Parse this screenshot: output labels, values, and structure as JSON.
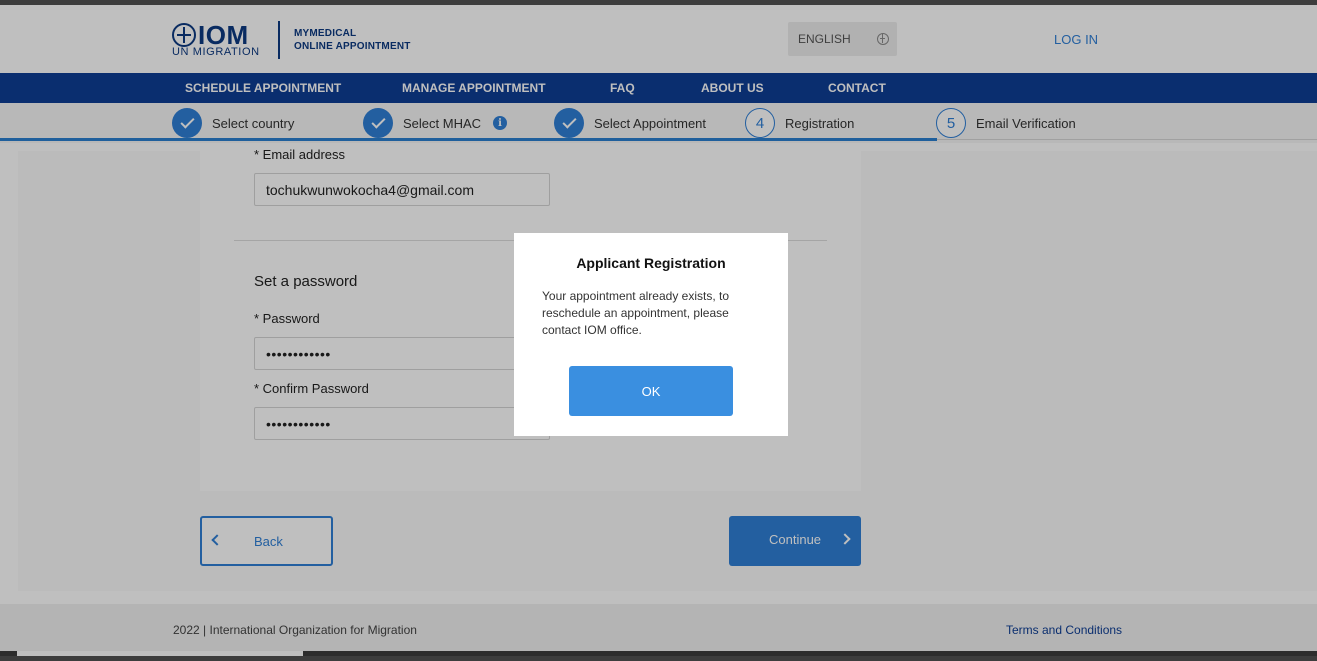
{
  "header": {
    "logo_main": "IOM",
    "logo_sub": "UN MIGRATION",
    "app_name_line1": "MYMEDICAL",
    "app_name_line2": "ONLINE APPOINTMENT",
    "language": "ENGLISH",
    "login": "LOG IN"
  },
  "nav": {
    "items": [
      "SCHEDULE APPOINTMENT",
      "MANAGE APPOINTMENT",
      "FAQ",
      "ABOUT US",
      "CONTACT"
    ]
  },
  "steps": [
    {
      "label": "Select country",
      "state": "done"
    },
    {
      "label": "Select MHAC",
      "state": "done",
      "info": "i"
    },
    {
      "label": "Select Appointment",
      "state": "done"
    },
    {
      "label": "Registration",
      "state": "current",
      "number": "4"
    },
    {
      "label": "Email Verification",
      "state": "pending",
      "number": "5"
    }
  ],
  "form": {
    "email_label": "* Email address",
    "email_value": "tochukwunwokocha4@gmail.com",
    "password_section_title": "Set a password",
    "password_label": "* Password",
    "password_value": "••••••••••••",
    "confirm_label": "* Confirm Password",
    "confirm_value": "••••••••••••"
  },
  "buttons": {
    "back": "Back",
    "continue": "Continue"
  },
  "footer": {
    "copyright": "2022  |  International Organization for Migration",
    "terms": "Terms and Conditions"
  },
  "modal": {
    "title": "Applicant Registration",
    "message": "Your appointment already exists, to reschedule an appointment, please contact IOM office.",
    "ok": "OK"
  },
  "colors": {
    "brand": "#0e3e95",
    "accent": "#2f7fd6"
  }
}
